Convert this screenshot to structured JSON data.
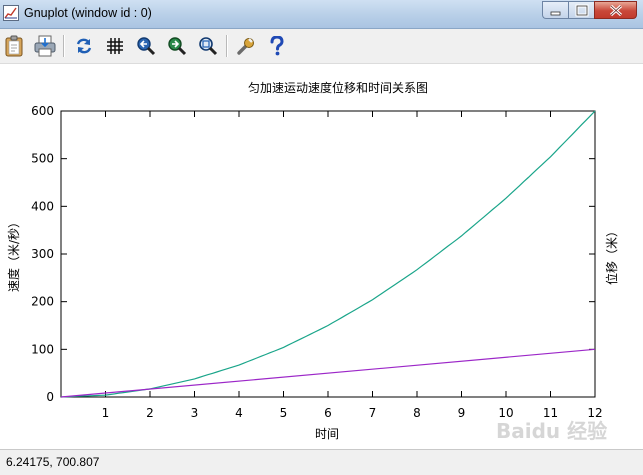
{
  "window": {
    "title": "Gnuplot (window id : 0)",
    "icon": "gnuplot-app-icon"
  },
  "toolbar": {
    "buttons": [
      {
        "name": "copy-to-clipboard",
        "icon": "clipboard-icon"
      },
      {
        "name": "print",
        "icon": "printer-icon"
      },
      {
        "name": "replot",
        "icon": "refresh-icon"
      },
      {
        "name": "toggle-grid",
        "icon": "grid-icon"
      },
      {
        "name": "previous-zoom",
        "icon": "zoom-back-icon"
      },
      {
        "name": "next-zoom",
        "icon": "zoom-forward-icon"
      },
      {
        "name": "autoscale",
        "icon": "zoom-autoscale-icon"
      },
      {
        "name": "options",
        "icon": "wrench-icon"
      },
      {
        "name": "help",
        "icon": "question-mark-icon"
      }
    ]
  },
  "status": {
    "coords": "6.24175,  700.807"
  },
  "watermark": {
    "text": "Baidu 经验"
  },
  "chart_data": {
    "type": "line",
    "title": "匀加速运动速度位移和时间关系图",
    "xlabel": "时间",
    "ylabel": "速度（米/秒）",
    "y2label": "位移（米）",
    "xlim": [
      0,
      12
    ],
    "ylim": [
      0,
      600
    ],
    "x_ticks": [
      1,
      2,
      3,
      4,
      5,
      6,
      7,
      8,
      9,
      10,
      11,
      12
    ],
    "y_ticks": [
      0,
      100,
      200,
      300,
      400,
      500,
      600
    ],
    "grid": false,
    "legend": "none",
    "series": [
      {
        "color": "#1aa58a",
        "x": [
          0,
          1,
          2,
          3,
          4,
          5,
          6,
          7,
          8,
          9,
          10,
          11,
          12
        ],
        "values": [
          0,
          4,
          17,
          38,
          67,
          104,
          150,
          204,
          267,
          338,
          417,
          504,
          600
        ]
      },
      {
        "color": "#9c27c8",
        "x": [
          0,
          12
        ],
        "values": [
          0,
          100
        ]
      }
    ]
  }
}
